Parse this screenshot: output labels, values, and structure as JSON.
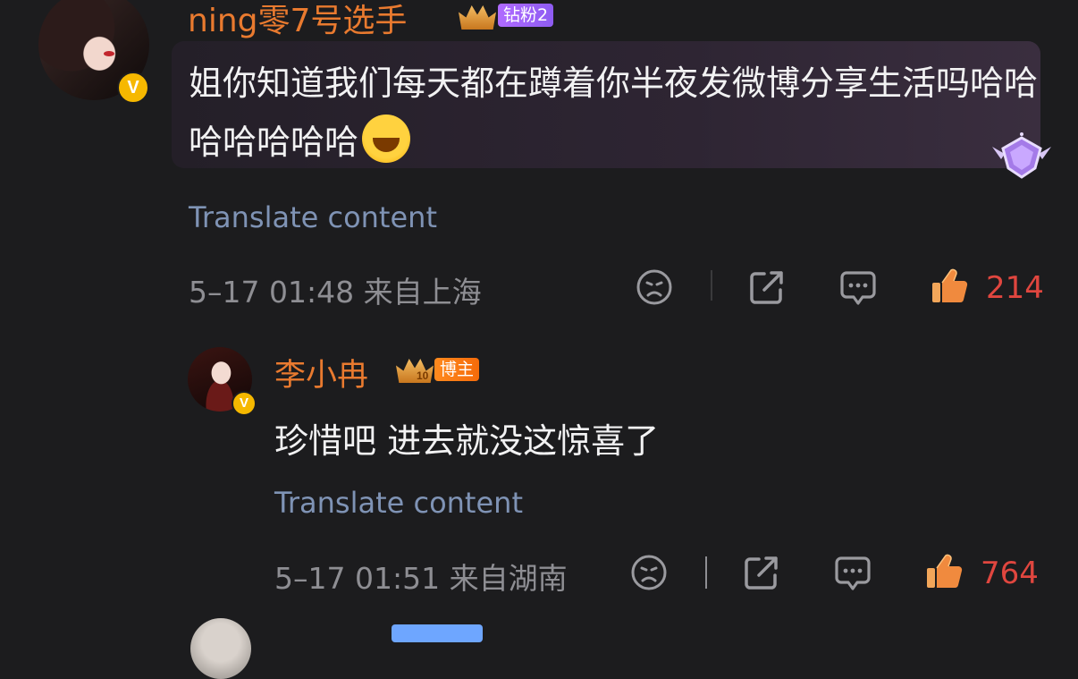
{
  "comment": {
    "username": "ning零7号选手",
    "fan_tag": "钻粉2",
    "text": "姐你知道我们每天都在蹲着你半夜发微博分享生活吗哈哈哈哈哈哈哈",
    "translate": "Translate content",
    "meta": "5–17 01:48 来自上海",
    "likes": "214",
    "verified_mark": "V"
  },
  "reply": {
    "username": "李小冉",
    "crown_level": "10",
    "role_tag": "博主",
    "text": "珍惜吧 进去就没这惊喜了",
    "translate": "Translate content",
    "meta": "5–17 01:51 来自湖南",
    "likes": "764",
    "verified_mark": "V"
  },
  "icons": [
    "dislike-face-icon",
    "share-icon",
    "comment-icon",
    "thumbs-up-icon",
    "diamond-badge-icon",
    "laughing-emoji-icon"
  ],
  "colors": {
    "background": "#1c1c1e",
    "username": "#e97a2f",
    "like_count": "#e0463f",
    "translate_link": "#7f93b5",
    "meta": "#8e8e93",
    "fan_tag": "#9d63f7",
    "role_tag": "#f57a12",
    "verified": "#f6b800"
  }
}
